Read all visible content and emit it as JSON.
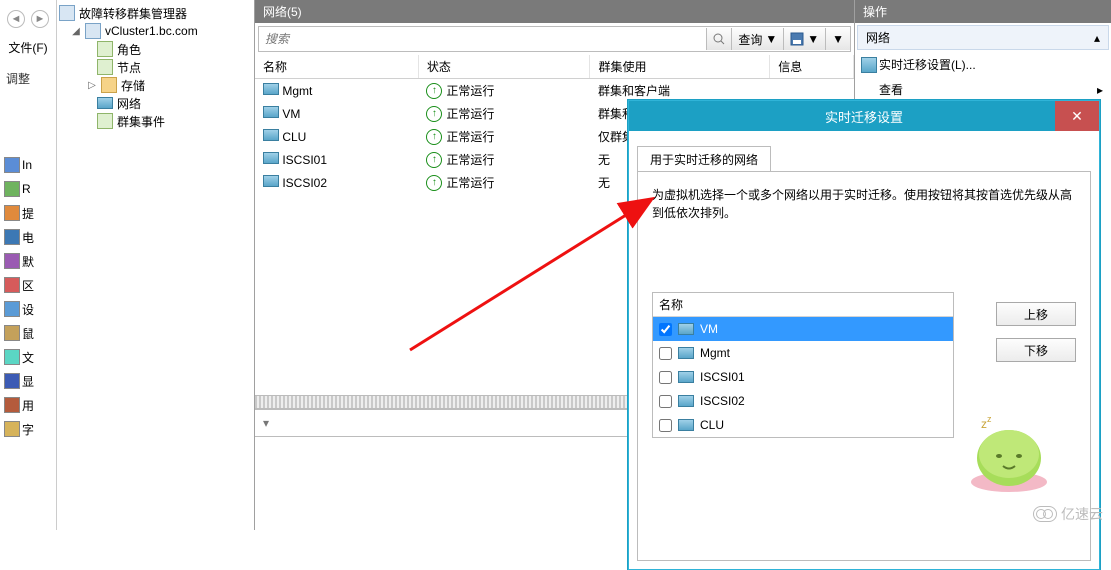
{
  "strip": {
    "file_menu": "文件(F)",
    "adjust": "调整",
    "quick": [
      "In",
      "R",
      "提",
      "电",
      "默",
      "区",
      "设",
      "鼠",
      "文",
      "显",
      "用",
      "字"
    ]
  },
  "tree": {
    "root": "故障转移群集管理器",
    "cluster": "vCluster1.bc.com",
    "items": [
      "角色",
      "节点",
      "存储",
      "网络",
      "群集事件"
    ]
  },
  "center": {
    "title": "网络(5)",
    "search_placeholder": "搜索",
    "query_btn": "查询",
    "cols": [
      "名称",
      "状态",
      "群集使用",
      "信息"
    ],
    "status_running": "正常运行",
    "rows": [
      {
        "name": "Mgmt",
        "use": "群集和客户端"
      },
      {
        "name": "VM",
        "use": "群集和客户端"
      },
      {
        "name": "CLU",
        "use": "仅群集"
      },
      {
        "name": "ISCSI01",
        "use": "无"
      },
      {
        "name": "ISCSI02",
        "use": "无"
      }
    ],
    "detail_chevron": "▾"
  },
  "actions": {
    "title": "操作",
    "sub": "网络",
    "items": [
      "实时迁移设置(L)...",
      "查看"
    ]
  },
  "dialog": {
    "title": "实时迁移设置",
    "tab": "用于实时迁移的网络",
    "desc": "为虚拟机选择一个或多个网络以用于实时迁移。使用按钮将其按首选优先级从高到低依次排列。",
    "col": "名称",
    "nets": [
      {
        "name": "VM",
        "checked": true,
        "sel": true
      },
      {
        "name": "Mgmt",
        "checked": false,
        "sel": false
      },
      {
        "name": "ISCSI01",
        "checked": false,
        "sel": false
      },
      {
        "name": "ISCSI02",
        "checked": false,
        "sel": false
      },
      {
        "name": "CLU",
        "checked": false,
        "sel": false
      }
    ],
    "up": "上移",
    "down": "下移"
  },
  "watermark": "亿速云"
}
